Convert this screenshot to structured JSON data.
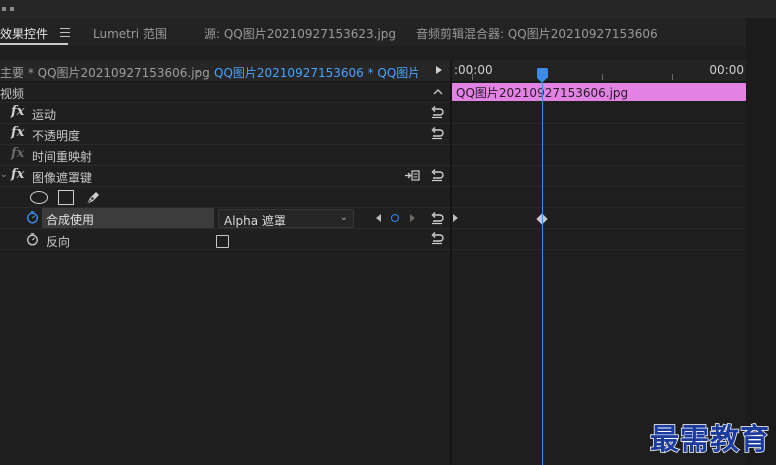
{
  "tabs": {
    "effect_controls": "效果控件",
    "lumetri": "Lumetri 范围",
    "source": "源: QQ图片20210927153623.jpg",
    "audio_mixer": "音频剪辑混合器: QQ图片20210927153606"
  },
  "clip_bar": {
    "master": "主要 * QQ图片20210927153606.jpg",
    "sequence": "QQ图片20210927153606 * QQ图片2..."
  },
  "timeline": {
    "time_start": ":00:00",
    "time_end": "00:00",
    "clip_name": "QQ图片20210927153606.jpg"
  },
  "effects": {
    "section_video": "视频",
    "motion": "运动",
    "opacity": "不透明度",
    "time_remap": "时间重映射",
    "image_matte": "图像遮罩键",
    "fx_symbol": "fx"
  },
  "properties": {
    "composite_label": "合成使用",
    "composite_value": "Alpha 遮罩",
    "reverse_label": "反向",
    "reverse_checked": false
  },
  "watermark": "最需教育",
  "colors": {
    "clip": "#e283e3",
    "playhead": "#3d8be8",
    "sequence_link": "#4aa3ff"
  }
}
